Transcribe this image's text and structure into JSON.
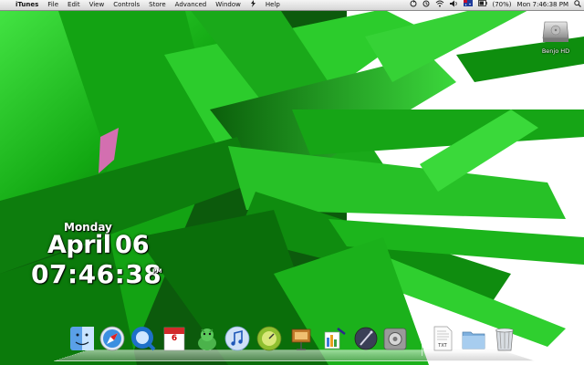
{
  "menubar": {
    "apple": "",
    "app_name": "iTunes",
    "items": [
      "File",
      "Edit",
      "View",
      "Controls",
      "Store",
      "Advanced",
      "Window",
      "Help"
    ],
    "battery": "(70%)",
    "clock": "Mon 7:46:38 PM"
  },
  "desktop": {
    "drive_label": "Benjo HD"
  },
  "clock_widget": {
    "weekday": "Monday",
    "month": "April",
    "day": "06",
    "time": "07:46:38",
    "ampm": "PM"
  },
  "dock": {
    "calendar_day": "6",
    "text_doc": "TXT",
    "items": [
      "finder-icon",
      "safari-icon",
      "quicktime-icon",
      "ical-icon",
      "adium-icon",
      "itunes-icon",
      "dashboard-icon",
      "keynote-icon",
      "ilife-icon",
      "script-editor-icon",
      "system-preferences-icon",
      "text-document-icon",
      "documents-folder-icon",
      "trash-icon"
    ]
  },
  "colors": {
    "wallpaper_green": "#1fbf1f",
    "wallpaper_dark": "#0a3a0a"
  }
}
